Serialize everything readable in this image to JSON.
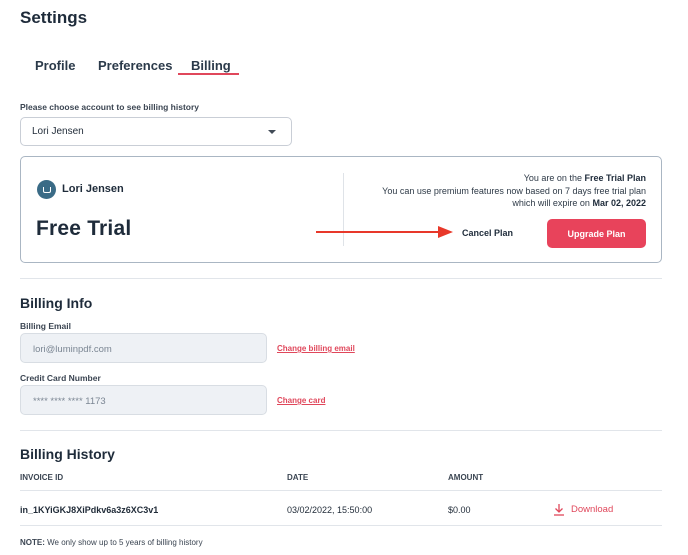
{
  "header": {
    "title": "Settings"
  },
  "tabs": [
    {
      "label": "Profile"
    },
    {
      "label": "Preferences"
    },
    {
      "label": "Billing",
      "active": true
    }
  ],
  "account_select": {
    "label": "Please choose account to see billing history",
    "value": "Lori Jensen"
  },
  "plan_card": {
    "user_name": "Lori Jensen",
    "plan_name": "Free Trial",
    "info_line1_prefix": "You are on the ",
    "info_line1_plan": "Free Trial Plan",
    "info_line2": "You can use premium features now based on 7 days free trial plan",
    "info_line3_prefix": "which will expire on ",
    "info_line3_date": "Mar 02, 2022",
    "cancel_label": "Cancel Plan",
    "upgrade_label": "Upgrade Plan"
  },
  "billing_info": {
    "title": "Billing Info",
    "email_label": "Billing Email",
    "email_value": "lori@luminpdf.com",
    "change_email_label": "Change billing email",
    "card_label": "Credit Card Number",
    "card_value": "**** **** **** 1173",
    "change_card_label": "Change card"
  },
  "billing_history": {
    "title": "Billing History",
    "columns": [
      "INVOICE ID",
      "DATE",
      "AMOUNT"
    ],
    "rows": [
      {
        "invoice_id": "in_1KYiGKJ8XiPdkv6a3z6XC3v1",
        "date": "03/02/2022, 15:50:00",
        "amount": "$0.00",
        "action": "Download"
      }
    ],
    "note_prefix": "NOTE:",
    "note_text": " We only show up to 5 years of billing history"
  },
  "colors": {
    "accent": "#e8435b",
    "avatar": "#3a6b86",
    "arrow": "#e8382a"
  },
  "icons": {
    "avatar": "avatar-icon",
    "caret": "chevron-down-icon",
    "download": "download-icon",
    "arrow": "arrow-right-icon"
  }
}
